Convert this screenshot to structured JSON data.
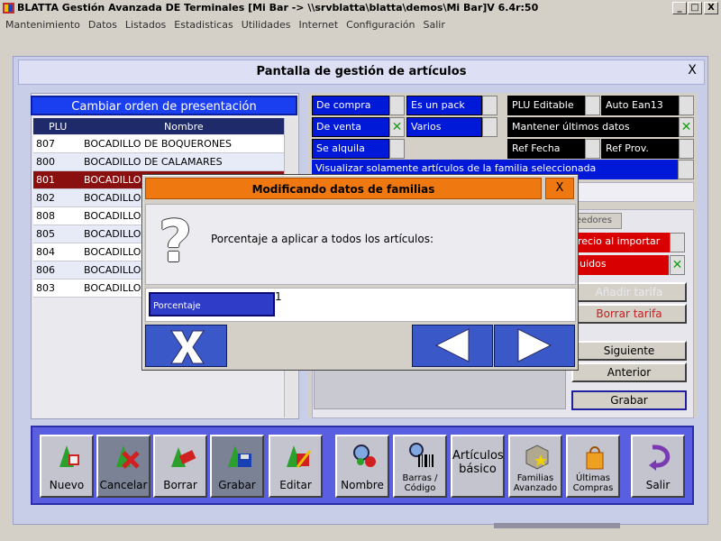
{
  "window": {
    "title": "BLATTA Gestión Avanzada DE Terminales [Mi Bar -> \\\\srvblatta\\blatta\\demos\\Mi Bar]V 6.4r:50",
    "min_label": "_",
    "max_label": "□",
    "close_label": "X"
  },
  "menu": [
    "Mantenimiento",
    "Datos",
    "Listados",
    "Estadisticas",
    "Utilidades",
    "Internet",
    "Configuración",
    "Salir"
  ],
  "screen": {
    "title": "Pantalla de gestión de artículos",
    "close_label": "X"
  },
  "list": {
    "order_button": "Cambiar orden de presentación",
    "columns": [
      "PLU",
      "Nombre"
    ],
    "rows": [
      {
        "plu": "807",
        "name": "BOCADILLO DE BOQUERONES"
      },
      {
        "plu": "800",
        "name": "BOCADILLO DE CALAMARES"
      },
      {
        "plu": "801",
        "name": "BOCADILLO "
      },
      {
        "plu": "802",
        "name": "BOCADILLO I"
      },
      {
        "plu": "808",
        "name": "BOCADILLO I"
      },
      {
        "plu": "805",
        "name": "BOCADILLO I"
      },
      {
        "plu": "804",
        "name": "BOCADILLO I"
      },
      {
        "plu": "806",
        "name": "BOCADILLO I"
      },
      {
        "plu": "803",
        "name": "BOCADILLO I"
      }
    ],
    "selected_index": 2
  },
  "options": {
    "de_compra": "De compra",
    "es_un_pack": "Es un pack",
    "plu_editable": "PLU Editable",
    "auto_ean": "Auto Ean13",
    "de_venta": "De venta",
    "varios": "Varios",
    "mantener": "Mantener últimos datos",
    "se_alquila": "Se alquila",
    "ref_fecha": "Ref Fecha",
    "ref_prov": "Ref Prov.",
    "filter_text": "Visualizar solamente artículos de la familia seleccionada",
    "check_mark": "✕"
  },
  "right": {
    "tab_acreedores": "reedores",
    "precio_importar": "precio al importar",
    "incluidos": "cluidos",
    "anadir_tarifa": "Añadir tarifa",
    "borrar_tarifa": "Borrar tarifa",
    "siguiente": "Siguiente",
    "anterior": "Anterior",
    "grabar": "Grabar"
  },
  "dialog": {
    "title": "Modificando datos de familias",
    "close_label": "X",
    "icon": "question-icon",
    "message": "Porcentaje a aplicar a todos los artículos:",
    "field_label": "Porcentaje",
    "field_value": "1"
  },
  "toolbar": {
    "nuevo": "Nuevo",
    "cancelar": "Cancelar",
    "borrar": "Borrar",
    "grabar": "Grabar",
    "editar": "Editar",
    "nombre": "Nombre",
    "barras": "Barras /\nCódigo",
    "articulos_basico": "Artículos básico",
    "familias": "Familias Avanzado",
    "ultimas": "Últimas Compras",
    "salir": "Salir"
  },
  "colors": {
    "accent_blue": "#0018d8",
    "dialog_orange": "#f07810",
    "selected_row": "#8a1010",
    "toolbar_blue": "#5a5ee0"
  }
}
